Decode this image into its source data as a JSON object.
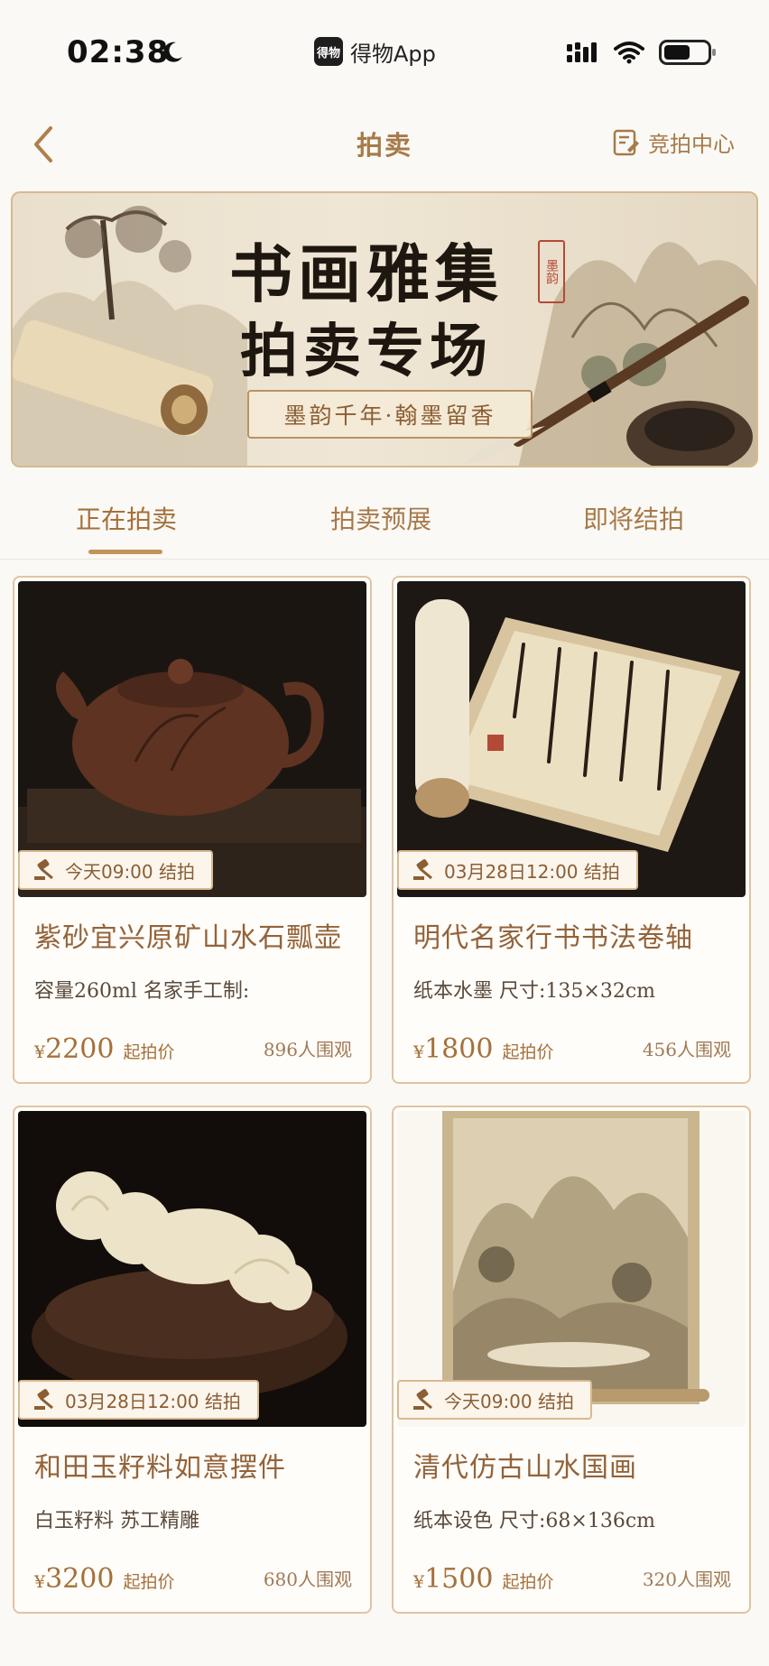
{
  "status_bar": {
    "time": "02:38",
    "app_logo": "得物",
    "app_name": "得物App"
  },
  "nav": {
    "title": "拍卖",
    "auction_center": "竞拍中心"
  },
  "banner": {
    "title_line1": "书画雅集",
    "title_line2": "拍卖专场",
    "seal": "墨韵",
    "slogan": "墨韵千年·翰墨留香"
  },
  "tabs": [
    {
      "label": "正在拍卖",
      "active": true
    },
    {
      "label": "拍卖预展",
      "active": false
    },
    {
      "label": "即将结拍",
      "active": false
    }
  ],
  "items": [
    {
      "deadline": "今天09:00 结拍",
      "title": "紫砂宜兴原矿山水石瓢壶",
      "desc": "容量260ml 名家手工制:",
      "currency": "¥",
      "price": "2200",
      "price_label": "起拍价",
      "watchers": "896人围观"
    },
    {
      "deadline": "03月28日12:00 结拍",
      "title": "明代名家行书书法卷轴",
      "desc": "纸本水墨 尺寸:135×32cm",
      "currency": "¥",
      "price": "1800",
      "price_label": "起拍价",
      "watchers": "456人围观"
    },
    {
      "deadline": "03月28日12:00 结拍",
      "title": "和田玉籽料如意摆件",
      "desc": "白玉籽料 苏工精雕",
      "currency": "¥",
      "price": "3200",
      "price_label": "起拍价",
      "watchers": "680人围观"
    },
    {
      "deadline": "今天09:00 结拍",
      "title": "清代仿古山水国画",
      "desc": "纸本设色 尺寸:68×136cm",
      "currency": "¥",
      "price": "1500",
      "price_label": "起拍价",
      "watchers": "320人围观"
    }
  ],
  "icons": {
    "moon": "moon-icon",
    "signal": "signal-icon",
    "wifi": "wifi-icon",
    "battery": "battery-icon",
    "back": "chevron-left-icon",
    "auction_center": "bid-list-icon",
    "gavel": "gavel-icon"
  },
  "colors": {
    "accent": "#a77a4a",
    "border": "#e0c4a1",
    "background": "#fbf9f5"
  }
}
